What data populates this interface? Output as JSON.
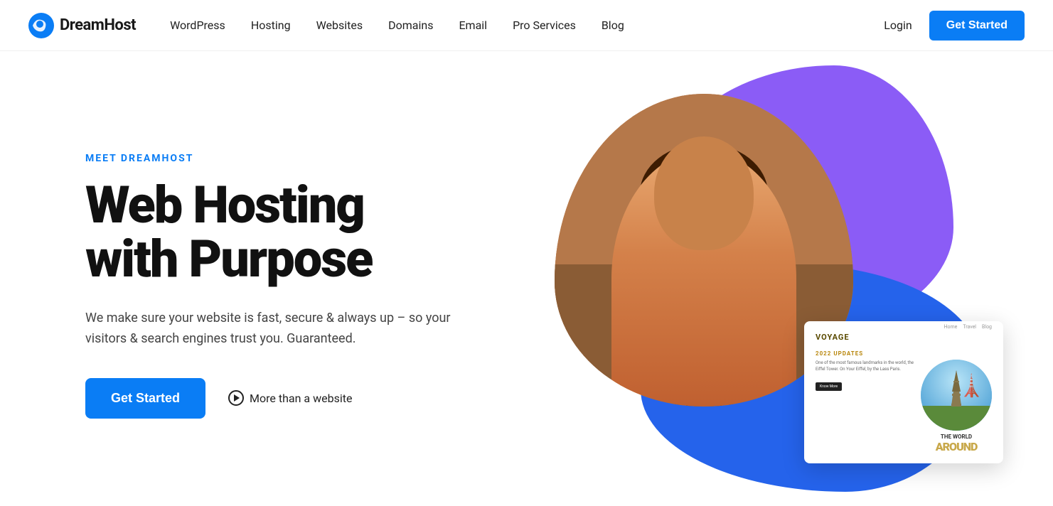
{
  "brand": {
    "name": "DreamHost",
    "logo_alt": "DreamHost logo"
  },
  "nav": {
    "links": [
      {
        "label": "WordPress",
        "id": "wordpress"
      },
      {
        "label": "Hosting",
        "id": "hosting"
      },
      {
        "label": "Websites",
        "id": "websites"
      },
      {
        "label": "Domains",
        "id": "domains"
      },
      {
        "label": "Email",
        "id": "email"
      },
      {
        "label": "Pro Services",
        "id": "pro-services"
      },
      {
        "label": "Blog",
        "id": "blog"
      }
    ],
    "login_label": "Login",
    "cta_label": "Get Started"
  },
  "hero": {
    "eyebrow": "MEET DREAMHOST",
    "title_line1": "Web Hosting",
    "title_line2": "with Purpose",
    "description": "We make sure your website is fast, secure & always up – so your visitors & search engines trust you. Guaranteed.",
    "cta_label": "Get Started",
    "more_label": "More than a website"
  },
  "card": {
    "site_title": "VOYAGE",
    "nav_links": [
      "Home",
      "Travel",
      "Blog"
    ],
    "eyebrow": "2022 UPDATES",
    "body_text": "One of the most famous landmarks in the world, the Eiffel Tower. On Your Eiffel, by the Lass Paris.",
    "know_more": "Know More",
    "big_label1": "THE WORLD",
    "big_label2": "AROUND"
  },
  "colors": {
    "brand_blue": "#0a7df5",
    "blob_purple": "#8b5cf6",
    "blob_blue": "#2563eb",
    "eyebrow_blue": "#0a7df5",
    "text_dark": "#111111",
    "text_medium": "#444444",
    "card_gold": "#c8a84a"
  }
}
